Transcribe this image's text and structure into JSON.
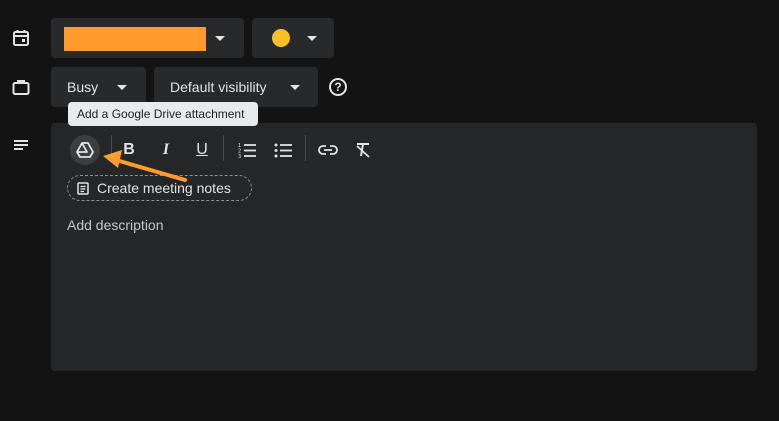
{
  "event_color_row": {
    "swatch_color": "#fe9a2e",
    "dot_color": "#f6c026",
    "icon": "calendar-icon"
  },
  "availability_row": {
    "icon": "briefcase-icon",
    "status": "Busy",
    "visibility": "Default visibility",
    "help_glyph": "?"
  },
  "tooltip": {
    "text": "Add a Google Drive attachment"
  },
  "editor": {
    "icon": "notes-icon",
    "toolbar": [
      "google-drive-icon",
      "bold-icon",
      "italic-icon",
      "underline-icon",
      "numbered-list-icon",
      "bulleted-list-icon",
      "link-icon",
      "clear-formatting-icon"
    ],
    "bold_glyph": "B",
    "italic_glyph": "I",
    "underline_glyph": "U",
    "meeting_notes_label": "Create meeting notes",
    "description_placeholder": "Add description"
  },
  "colors": {
    "background": "#131314",
    "surface": "#28292a",
    "editor": "#252627",
    "annotation_arrow": "#fe9a2e"
  }
}
